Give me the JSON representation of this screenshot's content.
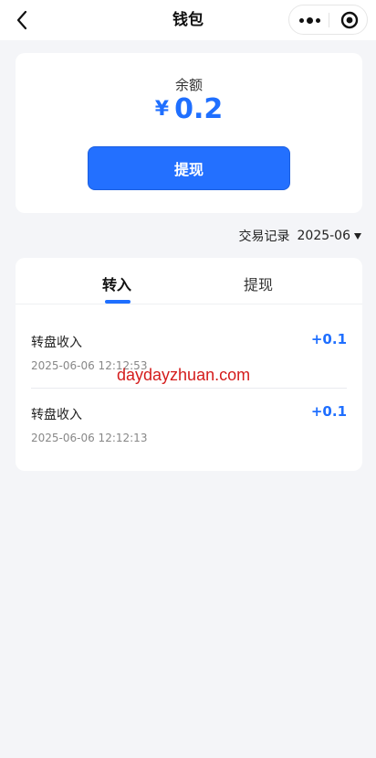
{
  "navbar": {
    "title": "钱包",
    "back_icon": "chevron-left-icon",
    "more_icon": "more-dots-icon",
    "close_icon": "target-circle-icon"
  },
  "balance": {
    "label": "余额",
    "currency": "¥",
    "amount": "0.2",
    "withdraw_button": "提现"
  },
  "records": {
    "filter_label": "交易记录",
    "filter_month": "2025-06",
    "tabs": [
      {
        "label": "转入",
        "active": true
      },
      {
        "label": "提现",
        "active": false
      }
    ],
    "items": [
      {
        "title": "转盘收入",
        "time": "2025-06-06 12:12:53",
        "amount": "+0.1"
      },
      {
        "title": "转盘收入",
        "time": "2025-06-06 12:12:13",
        "amount": "+0.1"
      }
    ]
  },
  "watermark": "daydayzhuan.com",
  "colors": {
    "accent": "#1f6fff",
    "background": "#f4f5f8",
    "watermark": "#d41c1c"
  }
}
